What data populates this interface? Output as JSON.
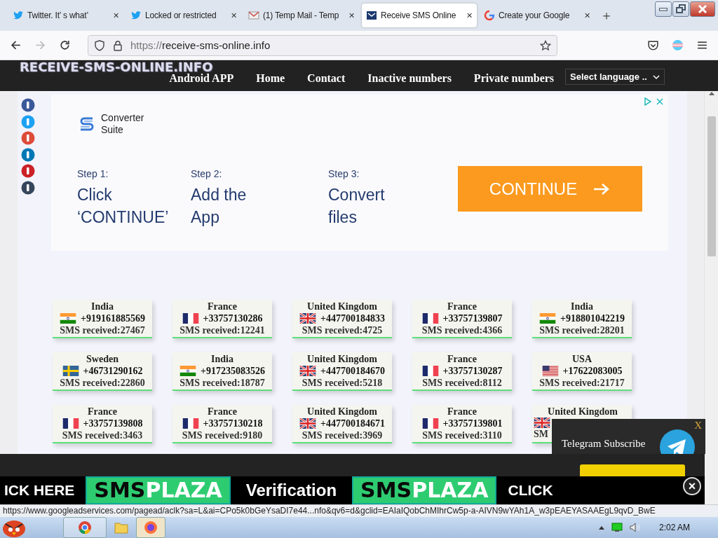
{
  "browser": {
    "tabs": [
      {
        "title": "Twitter. It’ s what’",
        "kind": "bird",
        "close": "✕",
        "selected": false
      },
      {
        "title": "Locked or restricted",
        "kind": "bird",
        "close": "✕",
        "selected": false
      },
      {
        "title": "(1) Temp Mail - Temp",
        "kind": "mail",
        "close": "✕",
        "selected": false
      },
      {
        "title": "Receive SMS Online",
        "kind": "envelope",
        "close": "✕",
        "selected": true
      },
      {
        "title": "Create your Google",
        "kind": "google",
        "close": "✕",
        "selected": false
      }
    ],
    "new_tab": "＋",
    "address": {
      "scheme": "https://",
      "host": "receive-sms-online.info"
    },
    "status_url": "https://www.googleadservices.com/pagead/aclk?sa=L&ai=CPo5k0bGeYsaDI7e44...nfo&qv6=d&gclid=EAIaIQobChMIhrCw5p-a-AIVN9wYAh1A_w3pEAEYASAAEgL9qvD_BwE"
  },
  "site": {
    "logo": "RECEIVE-SMS-ONLINE.INFO",
    "nav": [
      "Android APP",
      "Home",
      "Contact",
      "Inactive numbers",
      "Private numbers"
    ],
    "language": "Select language .."
  },
  "social": [
    {
      "kind": "facebook"
    },
    {
      "kind": "twitter"
    },
    {
      "kind": "googleplus"
    },
    {
      "kind": "linkedin"
    },
    {
      "kind": "pinterest"
    },
    {
      "kind": "tumblr"
    }
  ],
  "ad": {
    "brand": [
      "Converter",
      "Suite"
    ],
    "steps": [
      {
        "label": "Step 1:",
        "text": "Click ‘CONTINUE’"
      },
      {
        "label": "Step 2:",
        "text": "Add the App"
      },
      {
        "label": "Step 3:",
        "text": "Convert files"
      }
    ],
    "button": "CONTINUE"
  },
  "numbers": [
    {
      "country": "India",
      "kind": "india",
      "number": "+919161885569",
      "received": "SMS received:27467"
    },
    {
      "country": "France",
      "kind": "france",
      "number": "+33757130286",
      "received": "SMS received:12241"
    },
    {
      "country": "United Kingdom",
      "kind": "uk",
      "number": "+447700184833",
      "received": "SMS received:4725"
    },
    {
      "country": "France",
      "kind": "france",
      "number": "+33757139807",
      "received": "SMS received:4366"
    },
    {
      "country": "India",
      "kind": "india",
      "number": "+918801042219",
      "received": "SMS received:28201"
    },
    {
      "country": "Sweden",
      "kind": "sweden",
      "number": "+46731290162",
      "received": "SMS received:22860"
    },
    {
      "country": "India",
      "kind": "india",
      "number": "+917235083526",
      "received": "SMS received:18787"
    },
    {
      "country": "United Kingdom",
      "kind": "uk",
      "number": "+447700184670",
      "received": "SMS received:5218"
    },
    {
      "country": "France",
      "kind": "france",
      "number": "+33757130287",
      "received": "SMS received:8112"
    },
    {
      "country": "USA",
      "kind": "usa",
      "number": "+17622083005",
      "received": "SMS received:21717"
    },
    {
      "country": "France",
      "kind": "france",
      "number": "+33757139808",
      "received": "SMS received:3463"
    },
    {
      "country": "France",
      "kind": "france",
      "number": "+33757130218",
      "received": "SMS received:9180"
    },
    {
      "country": "United Kingdom",
      "kind": "uk",
      "number": "+447700184671",
      "received": "SMS received:3969"
    },
    {
      "country": "France",
      "kind": "france",
      "number": "+33757139801",
      "received": "SMS received:3110"
    },
    {
      "country": "United Kingdom",
      "kind": "uk",
      "received": "SM"
    }
  ],
  "telegram": {
    "close": "X",
    "label": "Telegram Subscribe"
  },
  "banner": {
    "left": "ICK HERE",
    "logos": [
      {
        "first": "SMS",
        "second": "PLAZA"
      },
      {
        "first": "SMS",
        "second": "PLAZA"
      }
    ],
    "middle": "Verification",
    "right": "CLICK",
    "close": "×"
  },
  "taskbar": {
    "clock": "2:02 AM"
  }
}
